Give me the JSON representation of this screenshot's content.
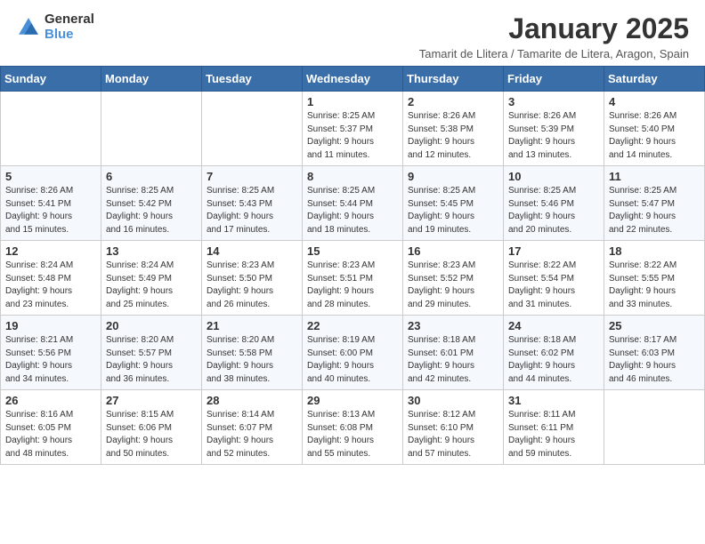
{
  "header": {
    "logo_line1": "General",
    "logo_line2": "Blue",
    "month_year": "January 2025",
    "location": "Tamarit de Llitera / Tamarite de Litera, Aragon, Spain"
  },
  "days_of_week": [
    "Sunday",
    "Monday",
    "Tuesday",
    "Wednesday",
    "Thursday",
    "Friday",
    "Saturday"
  ],
  "weeks": [
    [
      {
        "day": "",
        "info": ""
      },
      {
        "day": "",
        "info": ""
      },
      {
        "day": "",
        "info": ""
      },
      {
        "day": "1",
        "info": "Sunrise: 8:25 AM\nSunset: 5:37 PM\nDaylight: 9 hours\nand 11 minutes."
      },
      {
        "day": "2",
        "info": "Sunrise: 8:26 AM\nSunset: 5:38 PM\nDaylight: 9 hours\nand 12 minutes."
      },
      {
        "day": "3",
        "info": "Sunrise: 8:26 AM\nSunset: 5:39 PM\nDaylight: 9 hours\nand 13 minutes."
      },
      {
        "day": "4",
        "info": "Sunrise: 8:26 AM\nSunset: 5:40 PM\nDaylight: 9 hours\nand 14 minutes."
      }
    ],
    [
      {
        "day": "5",
        "info": "Sunrise: 8:26 AM\nSunset: 5:41 PM\nDaylight: 9 hours\nand 15 minutes."
      },
      {
        "day": "6",
        "info": "Sunrise: 8:25 AM\nSunset: 5:42 PM\nDaylight: 9 hours\nand 16 minutes."
      },
      {
        "day": "7",
        "info": "Sunrise: 8:25 AM\nSunset: 5:43 PM\nDaylight: 9 hours\nand 17 minutes."
      },
      {
        "day": "8",
        "info": "Sunrise: 8:25 AM\nSunset: 5:44 PM\nDaylight: 9 hours\nand 18 minutes."
      },
      {
        "day": "9",
        "info": "Sunrise: 8:25 AM\nSunset: 5:45 PM\nDaylight: 9 hours\nand 19 minutes."
      },
      {
        "day": "10",
        "info": "Sunrise: 8:25 AM\nSunset: 5:46 PM\nDaylight: 9 hours\nand 20 minutes."
      },
      {
        "day": "11",
        "info": "Sunrise: 8:25 AM\nSunset: 5:47 PM\nDaylight: 9 hours\nand 22 minutes."
      }
    ],
    [
      {
        "day": "12",
        "info": "Sunrise: 8:24 AM\nSunset: 5:48 PM\nDaylight: 9 hours\nand 23 minutes."
      },
      {
        "day": "13",
        "info": "Sunrise: 8:24 AM\nSunset: 5:49 PM\nDaylight: 9 hours\nand 25 minutes."
      },
      {
        "day": "14",
        "info": "Sunrise: 8:23 AM\nSunset: 5:50 PM\nDaylight: 9 hours\nand 26 minutes."
      },
      {
        "day": "15",
        "info": "Sunrise: 8:23 AM\nSunset: 5:51 PM\nDaylight: 9 hours\nand 28 minutes."
      },
      {
        "day": "16",
        "info": "Sunrise: 8:23 AM\nSunset: 5:52 PM\nDaylight: 9 hours\nand 29 minutes."
      },
      {
        "day": "17",
        "info": "Sunrise: 8:22 AM\nSunset: 5:54 PM\nDaylight: 9 hours\nand 31 minutes."
      },
      {
        "day": "18",
        "info": "Sunrise: 8:22 AM\nSunset: 5:55 PM\nDaylight: 9 hours\nand 33 minutes."
      }
    ],
    [
      {
        "day": "19",
        "info": "Sunrise: 8:21 AM\nSunset: 5:56 PM\nDaylight: 9 hours\nand 34 minutes."
      },
      {
        "day": "20",
        "info": "Sunrise: 8:20 AM\nSunset: 5:57 PM\nDaylight: 9 hours\nand 36 minutes."
      },
      {
        "day": "21",
        "info": "Sunrise: 8:20 AM\nSunset: 5:58 PM\nDaylight: 9 hours\nand 38 minutes."
      },
      {
        "day": "22",
        "info": "Sunrise: 8:19 AM\nSunset: 6:00 PM\nDaylight: 9 hours\nand 40 minutes."
      },
      {
        "day": "23",
        "info": "Sunrise: 8:18 AM\nSunset: 6:01 PM\nDaylight: 9 hours\nand 42 minutes."
      },
      {
        "day": "24",
        "info": "Sunrise: 8:18 AM\nSunset: 6:02 PM\nDaylight: 9 hours\nand 44 minutes."
      },
      {
        "day": "25",
        "info": "Sunrise: 8:17 AM\nSunset: 6:03 PM\nDaylight: 9 hours\nand 46 minutes."
      }
    ],
    [
      {
        "day": "26",
        "info": "Sunrise: 8:16 AM\nSunset: 6:05 PM\nDaylight: 9 hours\nand 48 minutes."
      },
      {
        "day": "27",
        "info": "Sunrise: 8:15 AM\nSunset: 6:06 PM\nDaylight: 9 hours\nand 50 minutes."
      },
      {
        "day": "28",
        "info": "Sunrise: 8:14 AM\nSunset: 6:07 PM\nDaylight: 9 hours\nand 52 minutes."
      },
      {
        "day": "29",
        "info": "Sunrise: 8:13 AM\nSunset: 6:08 PM\nDaylight: 9 hours\nand 55 minutes."
      },
      {
        "day": "30",
        "info": "Sunrise: 8:12 AM\nSunset: 6:10 PM\nDaylight: 9 hours\nand 57 minutes."
      },
      {
        "day": "31",
        "info": "Sunrise: 8:11 AM\nSunset: 6:11 PM\nDaylight: 9 hours\nand 59 minutes."
      },
      {
        "day": "",
        "info": ""
      }
    ]
  ]
}
